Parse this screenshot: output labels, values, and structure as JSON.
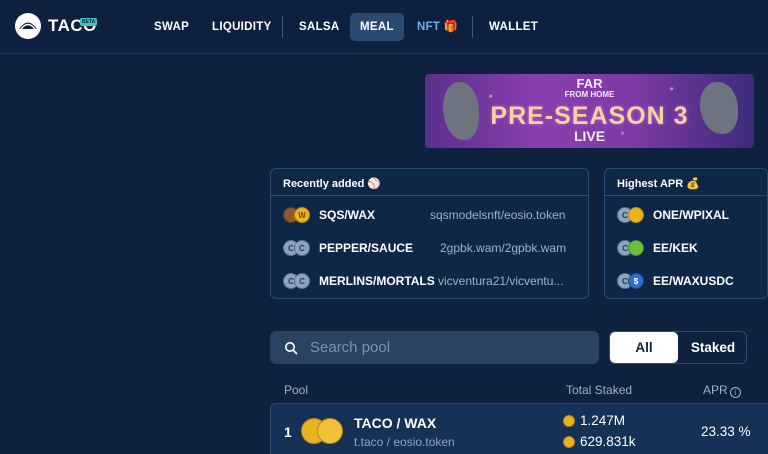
{
  "header": {
    "logo_text": "TACO",
    "beta_badge": "BETA",
    "nav": [
      {
        "label": "SWAP"
      },
      {
        "label": "LIQUIDITY"
      },
      {
        "label": "SALSA"
      },
      {
        "label": "MEAL",
        "active": true
      },
      {
        "label": "NFT 🎁"
      },
      {
        "label": "WALLET"
      }
    ]
  },
  "banner": {
    "line1": "FAR",
    "line2": "FROM HOME",
    "main": "PRE-SEASON 3",
    "live": "LIVE"
  },
  "recently_added": {
    "title": "Recently added ⚾",
    "rows": [
      {
        "pair": "SQS/WAX",
        "contract": "sqsmodelsnft/eosio.token"
      },
      {
        "pair": "PEPPER/SAUCE",
        "contract": "2gpbk.wam/2gpbk.wam"
      },
      {
        "pair": "MERLINS/MORTALS",
        "contract": "vicventura21/vicventu..."
      }
    ]
  },
  "highest_apr": {
    "title": "Highest APR 💰",
    "rows": [
      {
        "pair": "ONE/WPIXAL"
      },
      {
        "pair": "EE/KEK"
      },
      {
        "pair": "EE/WAXUSDC"
      }
    ]
  },
  "search": {
    "placeholder": "Search pool"
  },
  "filter": {
    "all": "All",
    "staked": "Staked"
  },
  "table": {
    "headers": {
      "pool": "Pool",
      "total_staked": "Total Staked",
      "apr": "APR"
    },
    "rows": [
      {
        "rank": "1",
        "name": "TACO / WAX",
        "contract": "t.taco / eosio.token",
        "staked_a": "1.247M",
        "staked_b": "629.831k",
        "apr": "23.33 %"
      }
    ]
  },
  "colors": {
    "background": "#0e2240",
    "accent_nft": "#6fb1e6",
    "active_tab": "#2a4a73"
  }
}
